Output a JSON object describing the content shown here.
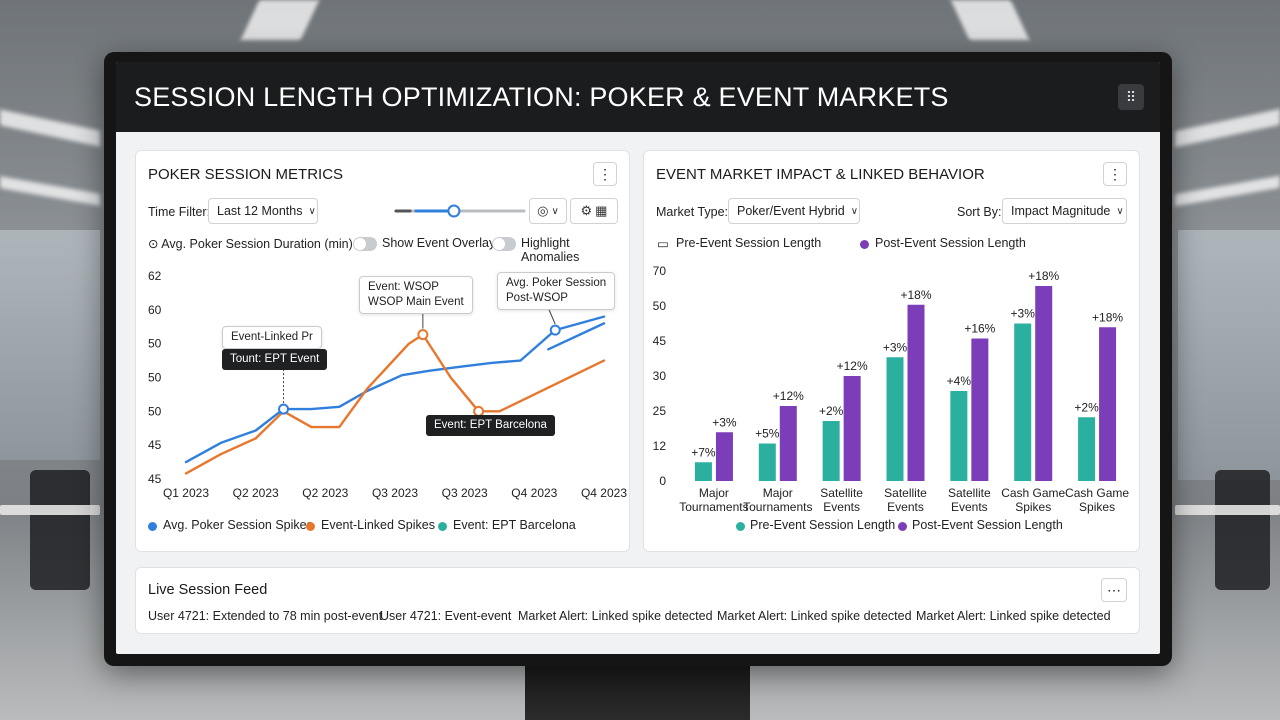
{
  "header": {
    "title": "SESSION LENGTH OPTIMIZATION: POKER & EVENT MARKETS"
  },
  "poker_panel": {
    "title": "POKER SESSION METRICS",
    "time_filter_label": "Time Filter:",
    "time_filter_value": "Last 12 Months",
    "metric_label": "Avg. Poker Session Duration (min)",
    "toggle_overlays_label": "Show Event Overlays",
    "toggle_anomalies_label": "Highlight Anomalies",
    "slider_value": 0.45,
    "annotations": {
      "wsop_line1": "Event: WSOP",
      "wsop_line2": "WSOP Main Event",
      "avg_line1": "Avg. Poker Session",
      "avg_line2": "Post-WSOP",
      "linked_line1": "Event-Linked Pr",
      "linked_line2": "Tount: EPT Event",
      "ept_barcelona": "Event: EPT Barcelona"
    },
    "legend": [
      "Avg. Poker Session Spikes",
      "Event-Linked Spikes",
      "Event: EPT Barcelona"
    ]
  },
  "event_panel": {
    "title": "EVENT MARKET IMPACT & LINKED BEHAVIOR",
    "market_type_label": "Market Type:",
    "market_type_value": "Poker/Event Hybrid",
    "sort_by_label": "Sort By:",
    "sort_by_value": "Impact Magnitude",
    "legend_top": [
      "Pre-Event Session Length",
      "Post-Event Session Length"
    ],
    "legend_bottom": [
      "Pre-Event Session Length",
      "Post-Event Session Length"
    ]
  },
  "feed": {
    "title": "Live Session Feed",
    "items": [
      "User 4721: Extended to 78 min post-event",
      "User 4721: Event-event",
      "Market Alert: Linked spike detected",
      "Market Alert: Linked spike detected",
      "Market Alert: Linked spike detected"
    ]
  },
  "colors": {
    "blue": "#2f7fdc",
    "orange": "#e8772e",
    "teal": "#2bb0a0",
    "purple": "#7b3db8"
  },
  "chart_data": [
    {
      "type": "line",
      "title": "POKER SESSION METRICS",
      "ylabel": "Avg. Poker Session Duration (min)",
      "y_tick_labels": [
        "62",
        "60",
        "50",
        "50",
        "50",
        "45",
        "45"
      ],
      "x_tick_labels": [
        "Q1 2023",
        "Q2 2023",
        "Q2 2023",
        "Q3 2023",
        "Q3 2023",
        "Q4 2023",
        "Q4 2023"
      ],
      "series": [
        {
          "name": "Avg. Poker Session Spikes",
          "color": "#2f7fdc",
          "points": [
            [
              0,
              45.5
            ],
            [
              0.5,
              47.2
            ],
            [
              1,
              48.3
            ],
            [
              1.4,
              50.2
            ],
            [
              1.8,
              50.2
            ],
            [
              2.2,
              50.4
            ],
            [
              2.6,
              51.8
            ],
            [
              3.1,
              53.2
            ],
            [
              3.5,
              53.6
            ],
            [
              4,
              54
            ],
            [
              4.4,
              54.3
            ],
            [
              4.8,
              54.5
            ],
            [
              5.3,
              57.2
            ],
            [
              6,
              58.4
            ]
          ]
        },
        {
          "name": "Event-Linked Spikes",
          "color": "#e8772e",
          "points": [
            [
              0,
              44.5
            ],
            [
              0.5,
              46.2
            ],
            [
              1,
              47.6
            ],
            [
              1.4,
              50
            ],
            [
              1.8,
              48.6
            ],
            [
              2.2,
              48.6
            ],
            [
              2.6,
              52
            ],
            [
              3.2,
              56
            ],
            [
              3.4,
              56.8
            ],
            [
              3.8,
              53
            ],
            [
              4.2,
              50
            ],
            [
              4.5,
              50
            ],
            [
              5.0,
              51.5
            ],
            [
              6,
              54.5
            ]
          ]
        },
        {
          "name": "Post-WSOP segment",
          "color": "#2f7fdc",
          "points": [
            [
              5.2,
              55.5
            ],
            [
              6,
              57.8
            ]
          ]
        }
      ]
    },
    {
      "type": "bar",
      "title": "EVENT MARKET IMPACT & LINKED BEHAVIOR",
      "y_tick_labels": [
        "0",
        "12",
        "25",
        "30",
        "45",
        "50",
        "70"
      ],
      "categories": [
        "Major Tournaments",
        "Major Tournaments",
        "Satellite Events",
        "Satellite Events",
        "Satellite Events",
        "Cash Game Spikes",
        "Cash Game Spikes"
      ],
      "series": [
        {
          "name": "Pre-Event Session Length",
          "color": "#2bb0a0",
          "values": [
            5,
            10,
            16,
            33,
            24,
            42,
            17
          ],
          "labels": [
            "+7%",
            "+5%",
            "+2%",
            "+3%",
            "+4%",
            "+3%",
            "+2%"
          ]
        },
        {
          "name": "Post-Event Session Length",
          "color": "#7b3db8",
          "values": [
            13,
            20,
            28,
            47,
            38,
            52,
            41
          ],
          "labels": [
            "+3%",
            "+12%",
            "+12%",
            "+18%",
            "+16%",
            "+18%",
            "+18%"
          ]
        }
      ]
    }
  ]
}
